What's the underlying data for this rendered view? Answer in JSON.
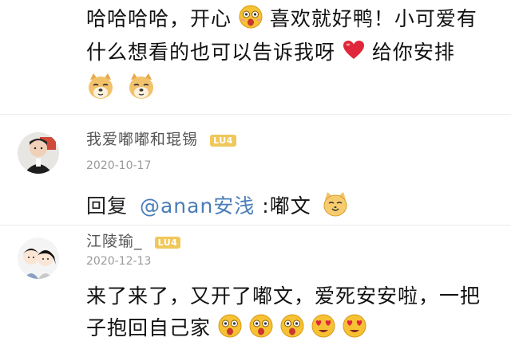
{
  "top_comment": {
    "line1_a": "哈哈哈哈，开心",
    "line1_b": "喜欢就好鸭！小可爱有",
    "line2_a": "什么想看的也可以告诉我呀",
    "line2_b": "给你安排",
    "emojis": [
      "excited-face-icon",
      "heart-icon",
      "doge-icon",
      "doge-icon"
    ]
  },
  "comment1": {
    "username": "我爱嘟嘟和琨锡",
    "badge": "LU4",
    "date": "2020-10-17",
    "reply_prefix": "回复",
    "mention": "@anan安浅",
    "reply_text": ":嘟文"
  },
  "comment2": {
    "username": "江陵瑜_",
    "badge": "LU4",
    "date": "2020-12-13",
    "line1": "来了来了，又开了嘟文，爱死安安啦，一把",
    "line2": "子抱回自己家"
  },
  "colors": {
    "badge": "#f0c75a",
    "mention": "#4a7db7",
    "heart": "#e0263a",
    "emoji_yellow": "#f6c234"
  }
}
